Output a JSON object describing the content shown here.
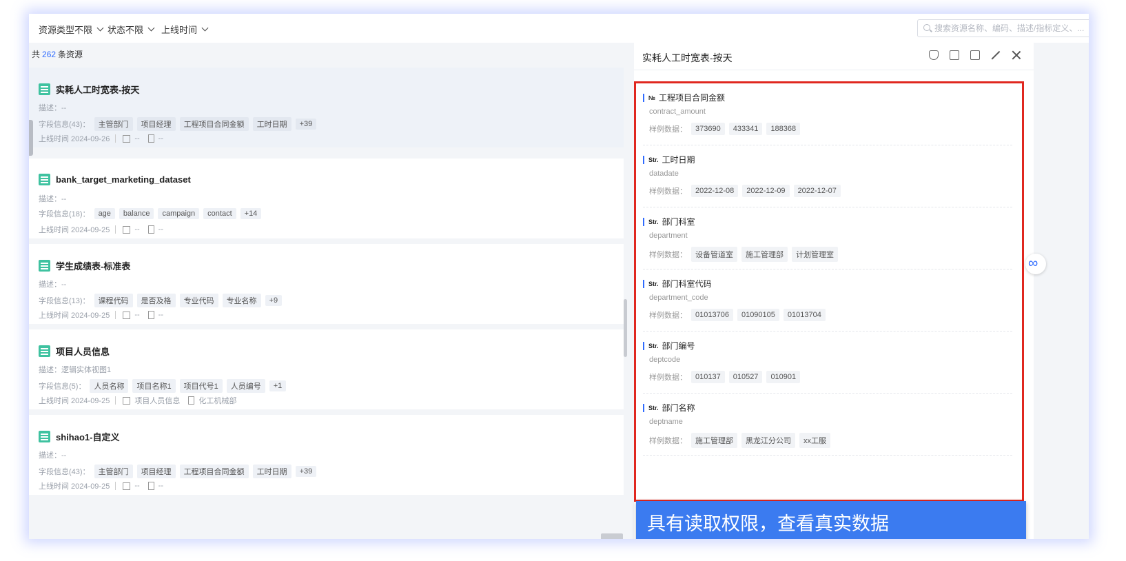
{
  "filters": [
    {
      "label": "资源类型不限"
    },
    {
      "label": "状态不限"
    },
    {
      "label": "上线时间"
    }
  ],
  "search": {
    "placeholder": "搜索资源名称、编码、描述/指标定义、..."
  },
  "summary": {
    "prefix": "共",
    "count": "262",
    "suffix": "条资源"
  },
  "cards": [
    {
      "title": "实耗人工时宽表-按天",
      "desc": "描述：--",
      "fields_label": "字段信息(43)：",
      "tags": [
        "主管部门",
        "项目经理",
        "工程项目合同金额",
        "工时日期",
        "+39"
      ],
      "online": "上线时间 2024-09-26",
      "m1": "--",
      "m2": "--"
    },
    {
      "title": "bank_target_marketing_dataset",
      "desc": "描述：--",
      "fields_label": "字段信息(18)：",
      "tags": [
        "age",
        "balance",
        "campaign",
        "contact",
        "+14"
      ],
      "online": "上线时间 2024-09-25",
      "m1": "--",
      "m2": "--"
    },
    {
      "title": "学生成绩表-标准表",
      "desc": "描述：--",
      "fields_label": "字段信息(13)：",
      "tags": [
        "课程代码",
        "是否及格",
        "专业代码",
        "专业名称",
        "+9"
      ],
      "online": "上线时间 2024-09-25",
      "m1": "--",
      "m2": "--"
    },
    {
      "title": "项目人员信息",
      "desc": "描述：逻辑实体视图1",
      "fields_label": "字段信息(5)：",
      "tags": [
        "人员名称",
        "项目名称1",
        "项目代号1",
        "人员编号",
        "+1"
      ],
      "online": "上线时间 2024-09-25",
      "m1": "项目人员信息",
      "m2": "化工机械部"
    },
    {
      "title": "shihao1-自定义",
      "desc": "描述：--",
      "fields_label": "字段信息(43)：",
      "tags": [
        "主管部门",
        "项目经理",
        "工程项目合同金额",
        "工时日期",
        "+39"
      ],
      "online": "上线时间 2024-09-25",
      "m1": "--",
      "m2": "--"
    }
  ],
  "panel": {
    "title": "实耗人工时宽表-按天",
    "sample_label": "样例数据：",
    "fields": [
      {
        "type": "№",
        "name": "工程项目合同金额",
        "code": "contract_amount",
        "samples": [
          "373690",
          "433341",
          "188368"
        ]
      },
      {
        "type": "Str.",
        "name": "工时日期",
        "code": "datadate",
        "samples": [
          "2022-12-08",
          "2022-12-09",
          "2022-12-07"
        ]
      },
      {
        "type": "Str.",
        "name": "部门科室",
        "code": "department",
        "samples": [
          "设备管道室",
          "施工管理部",
          "计划管理室"
        ]
      },
      {
        "type": "Str.",
        "name": "部门科室代码",
        "code": "department_code",
        "samples": [
          "01013706",
          "01090105",
          "01013704"
        ]
      },
      {
        "type": "Str.",
        "name": "部门编号",
        "code": "deptcode",
        "samples": [
          "010137",
          "010527",
          "010901"
        ]
      },
      {
        "type": "Str.",
        "name": "部门名称",
        "code": "deptname",
        "samples": [
          "施工管理部",
          "黑龙江分公司",
          "xx工服"
        ]
      }
    ],
    "banner": "具有读取权限，查看真实数据"
  },
  "colors": {
    "accent": "#2f6bff",
    "table_icon": "#3fc2a0",
    "highlight_border": "#e0271f",
    "banner": "#3b7bf0"
  }
}
